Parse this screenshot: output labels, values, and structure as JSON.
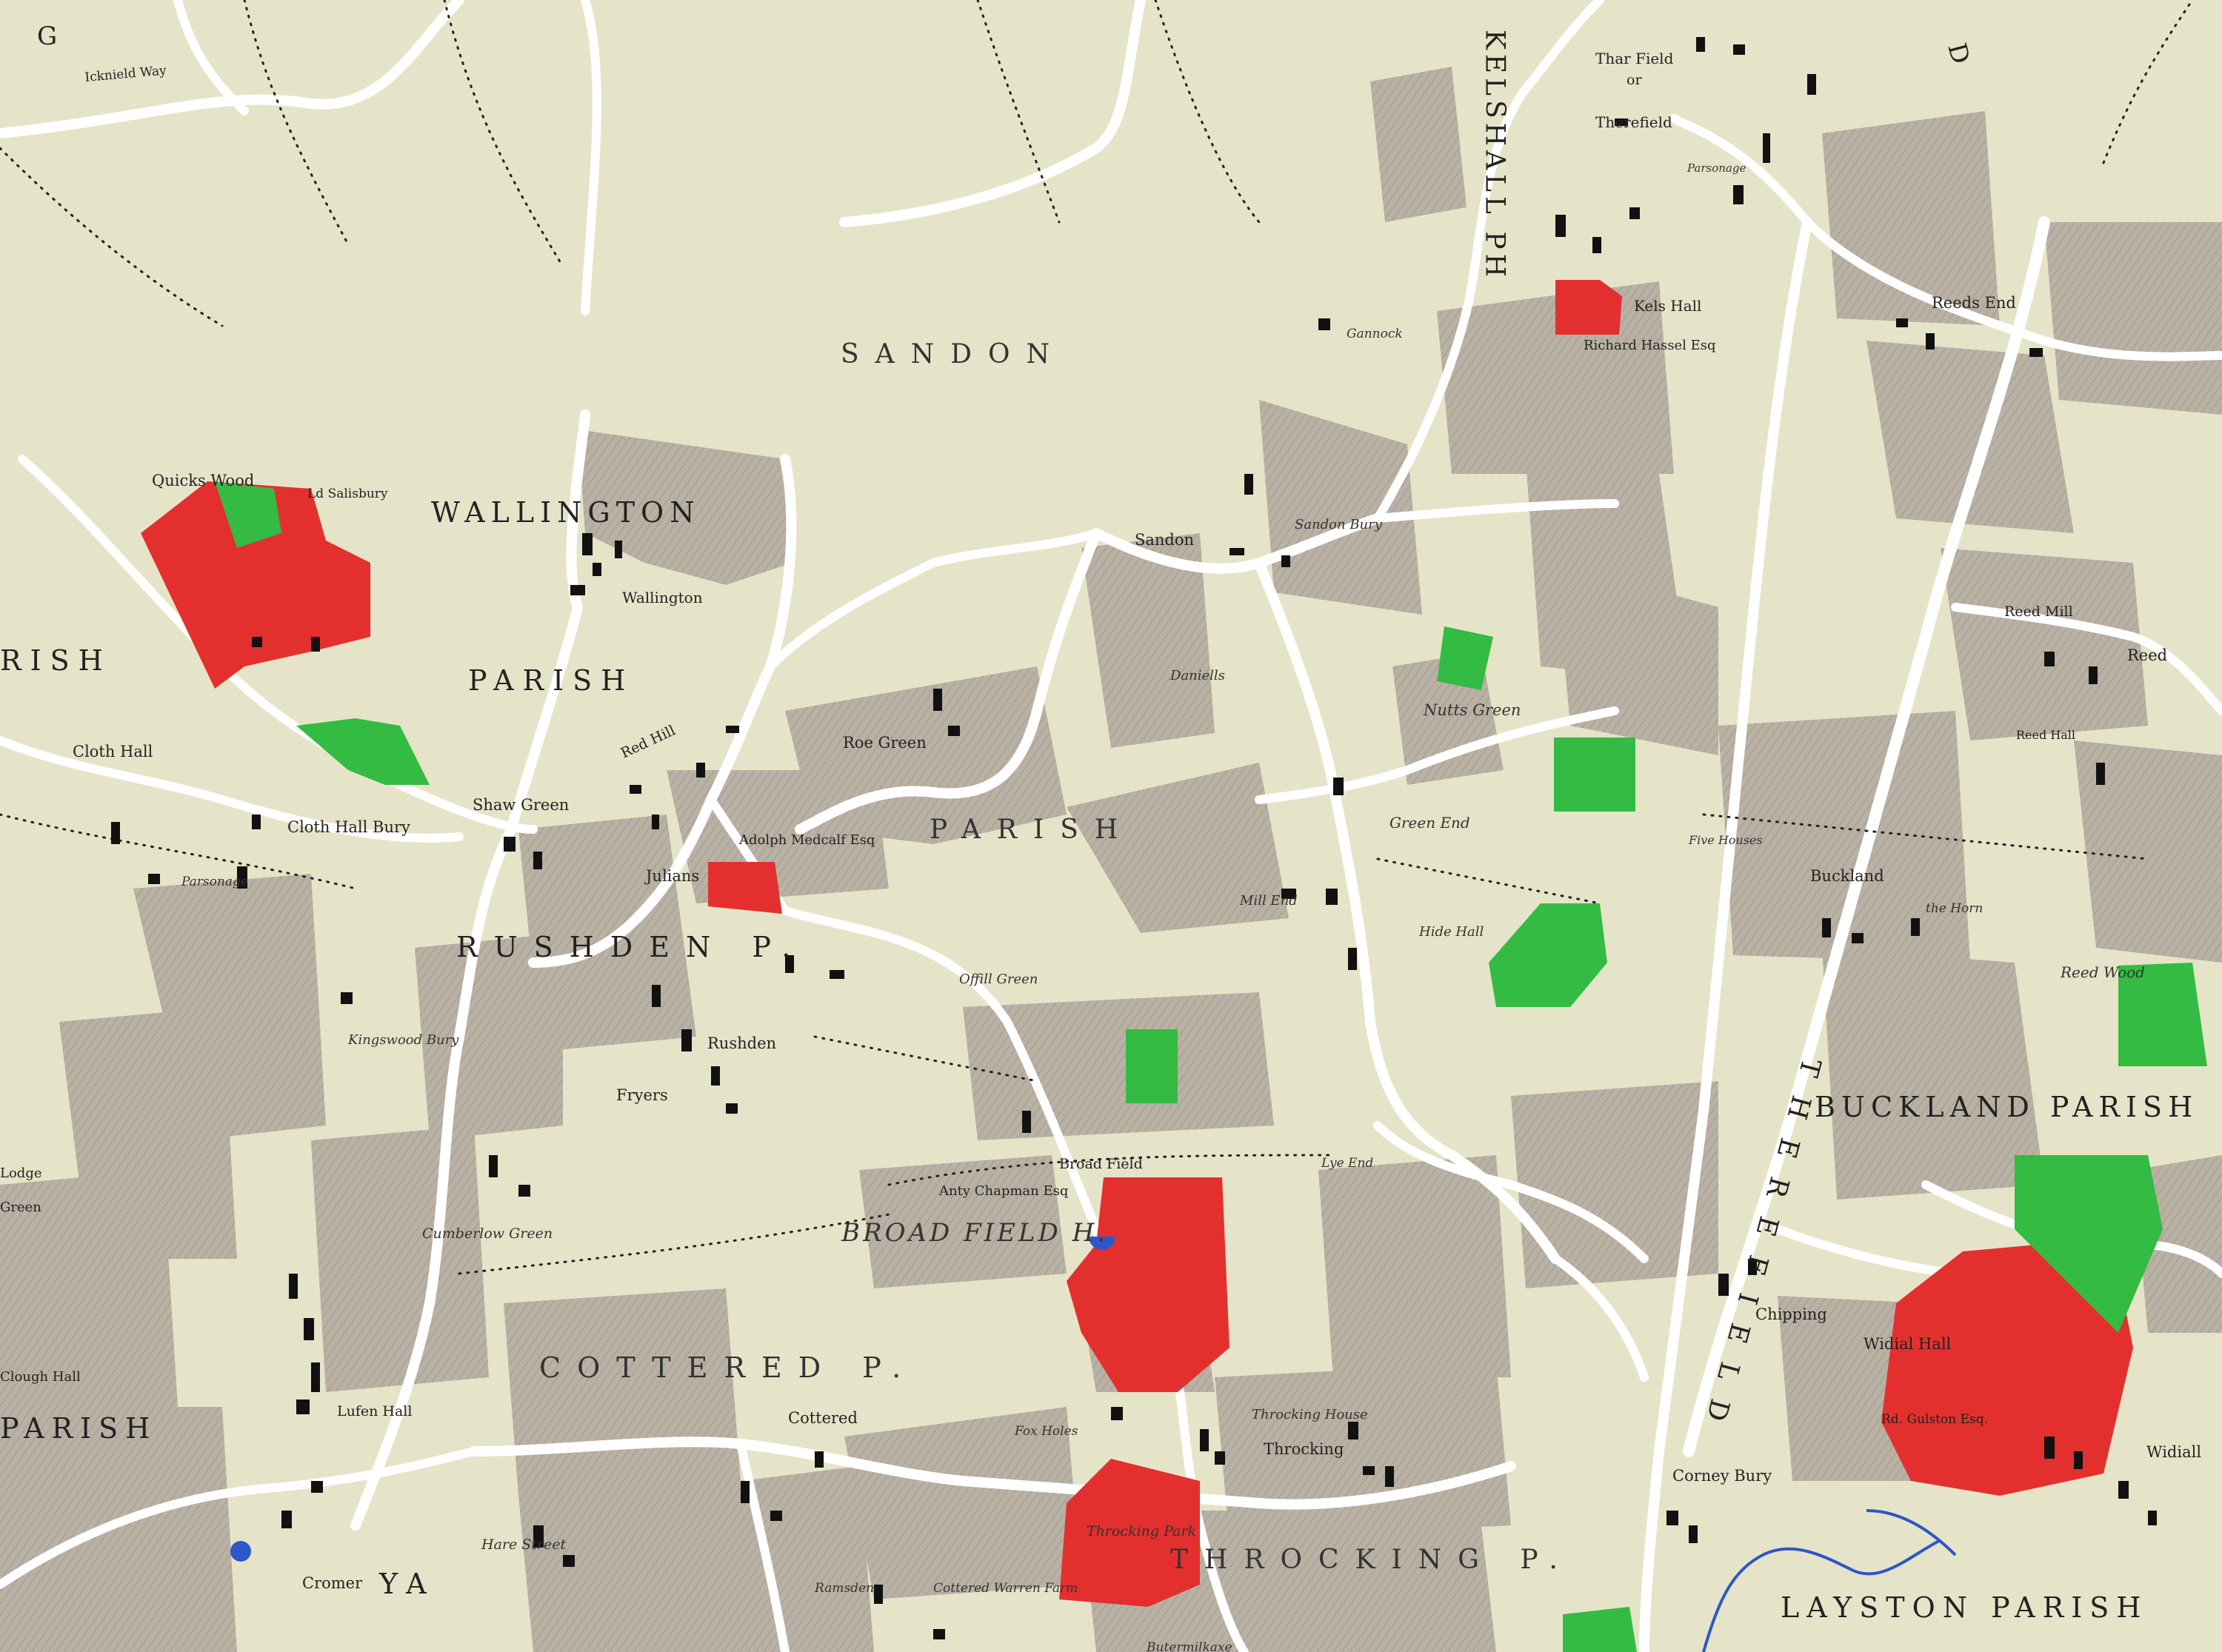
{
  "colors": {
    "background": "#e6e4c8",
    "road": "#ffffff",
    "field": "#b9b1a4",
    "estate": "#e3302f",
    "wood": "#33bb44",
    "water": "#2d56c8",
    "building": "#111111"
  },
  "labels": {
    "g_top": "G",
    "icknield_way": "Icknield Way",
    "sandon_big": "SANDON",
    "wallington_big": "WALLINGTON",
    "parish_left": "PARISH",
    "rish_left": "RISH",
    "quicks_wood": "Quicks Wood",
    "ld_salisbury": "Ld Salisbury",
    "wallington": "Wallington",
    "cloth_hall": "Cloth Hall",
    "cloth_hall_bury": "Cloth Hall Bury",
    "parsonage_left": "Parsonage",
    "shaw_green": "Shaw Green",
    "red_hill": "Red Hill",
    "julians": "Julians",
    "adolp": "Adolph Medcalf Esq",
    "roe_green": "Roe Green",
    "parish_mid": "PARISH",
    "rushden": "RUSHDEN P.",
    "kingswood_bury": "Kingswood Bury",
    "rushden_village": "Rushden",
    "fryers": "Fryers",
    "offill_green": "Offill Green",
    "lodge": "Lodge",
    "green_left": "Green",
    "cumberlow_green": "Cumberlow Green",
    "clough_hall": "Clough Hall",
    "parish_bottom_left": "PARISH",
    "lufen_hall": "Lufen Hall",
    "cottered_big": "COTTERED P.",
    "cottered": "Cottered",
    "hare_street": "Hare Street",
    "cromer": "Cromer",
    "ya": "YA",
    "ramsden": "Ramsden",
    "cottered_warren": "Cottered Warren Farm",
    "broad_field": "Broad Field",
    "chapman": "Anty Chapman Esq",
    "broad_field_h": "BROAD FIELD H.",
    "fox_holes": "Fox Holes",
    "throcking_park": "Throcking Park",
    "throcking_house": "Throcking House",
    "throcking": "Throcking",
    "throcking_p": "THROCKING P.",
    "butermilkaxe": "Butermilkaxe",
    "sandon": "Sandon",
    "sandon_bury": "Sandon Bury",
    "daniells": "Daniells",
    "gannock": "Gannock",
    "mill_end": "Mill End",
    "green_end": "Green End",
    "hide_hall": "Hide Hall",
    "nutts_green": "Nutts Green",
    "lye_end": "Lye End",
    "kels_hall": "Kels Hall",
    "richard_hassel": "Richard Hassel Esq",
    "kelshall_big": "KELSHALL PH",
    "thar_field": "Thar Field",
    "or": "or",
    "therefield_village": "Therefield",
    "parsonage_right": "Parsonage",
    "therefield_big": "THEREFIELD",
    "d_top": "D",
    "reeds_end": "Reeds End",
    "reed_mill": "Reed Mill",
    "reed": "Reed",
    "reed_hall": "Reed Hall",
    "five_houses": "Five Houses",
    "buckland": "Buckland",
    "the_horn": "the Horn",
    "reed_wood": "Reed Wood",
    "buckland_parish": "BUCKLAND PARISH",
    "chipping": "Chipping",
    "widial_hall": "Widial Hall",
    "gulston": "Rd. Gulston Esq.",
    "widiall": "Widiall",
    "corney_bury": "Corney Bury",
    "layston_parish": "LAYSTON PARISH"
  }
}
